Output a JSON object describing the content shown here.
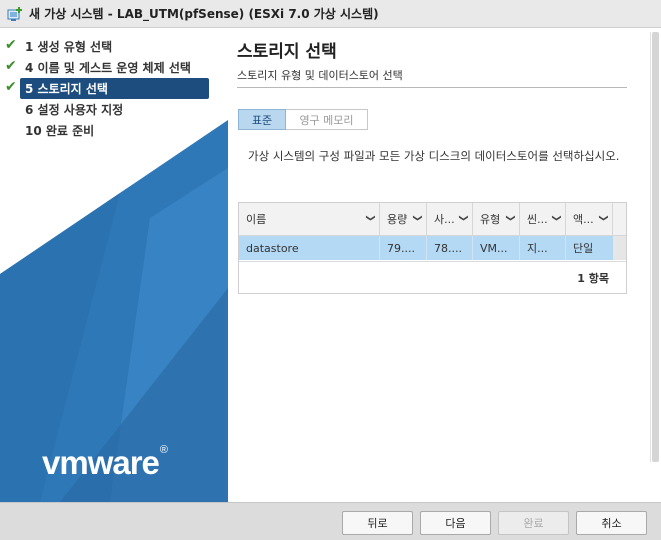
{
  "window": {
    "title": "새 가상 시스템 - LAB_UTM(pfSense) (ESXi 7.0 가상 시스템)"
  },
  "sidebar": {
    "steps": [
      {
        "label": "1 생성 유형 선택",
        "done": true
      },
      {
        "label": "4 이름 및 게스트 운영 체제 선택",
        "done": true
      },
      {
        "label": "5 스토리지 선택",
        "done": true,
        "active": true
      },
      {
        "label": "6 설정 사용자 지정",
        "done": false
      },
      {
        "label": "10 완료 준비",
        "done": false
      }
    ],
    "logo": {
      "text": "vmware",
      "mark": "®"
    }
  },
  "main": {
    "title": "스토리지 선택",
    "subtitle": "스토리지 유형 및 데이터스토어 선택",
    "tabs": [
      {
        "label": "표준",
        "selected": true
      },
      {
        "label": "영구 메모리",
        "selected": false
      }
    ],
    "description": "가상 시스템의 구성 파일과 모든 가상 디스크의 데이터스토어를 선택하십시오.",
    "table": {
      "columns": [
        "이름",
        "용량",
        "사...",
        "유형",
        "씬...",
        "액..."
      ],
      "rows": [
        [
          "datastore",
          "79....",
          "78....",
          "VM...",
          "지...",
          "단일"
        ]
      ],
      "count": "1 항목"
    }
  },
  "footer": {
    "back": "뒤로",
    "next": "다음",
    "finish": "완료",
    "cancel": "취소"
  },
  "colors": {
    "accent": "#1d4d7e",
    "selection": "#b3d9f5",
    "check": "#3a8f2a",
    "sidebar_blue": "#2f78b8"
  },
  "icons": {
    "window": "new-vm-icon",
    "check": "checkmark-icon",
    "sort": "chevron-down-icon"
  }
}
